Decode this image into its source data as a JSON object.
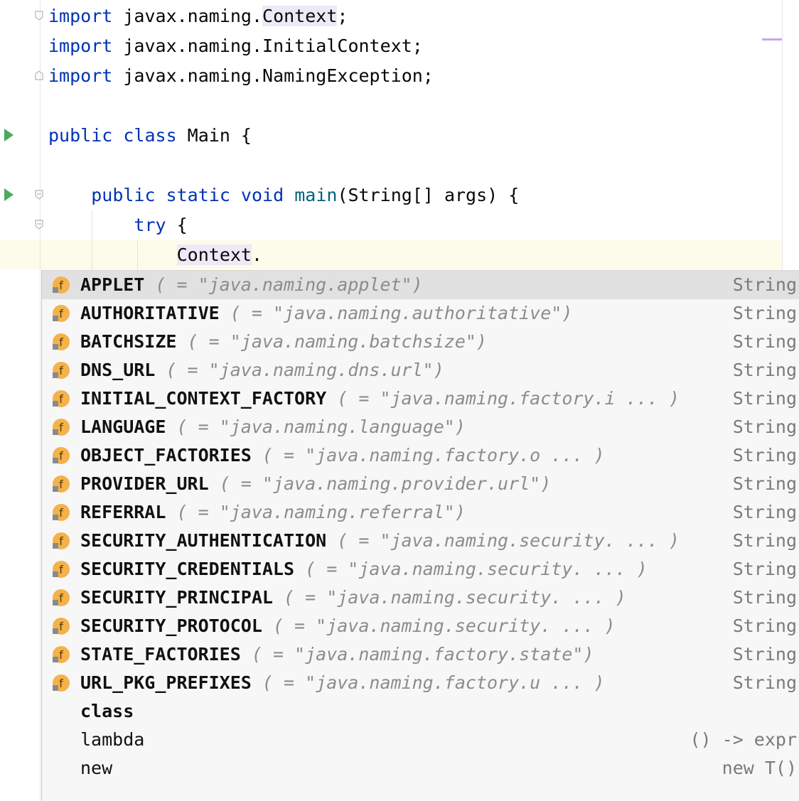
{
  "editor": {
    "lines": [
      {
        "segments": [
          {
            "t": "import",
            "c": "kw"
          },
          {
            "t": " javax.naming."
          },
          {
            "t": "Context",
            "c": "hl"
          },
          {
            "t": ";"
          }
        ]
      },
      {
        "segments": [
          {
            "t": "import",
            "c": "kw"
          },
          {
            "t": " javax.naming.InitialContext;"
          }
        ]
      },
      {
        "segments": [
          {
            "t": "import",
            "c": "kw"
          },
          {
            "t": " javax.naming.NamingException;"
          }
        ]
      },
      {
        "segments": []
      },
      {
        "segments": [
          {
            "t": "public class",
            "c": "kw"
          },
          {
            "t": " Main {"
          }
        ]
      },
      {
        "segments": []
      },
      {
        "segments": [
          {
            "t": "    "
          },
          {
            "t": "public static void",
            "c": "kw"
          },
          {
            "t": " "
          },
          {
            "t": "main",
            "c": "fn"
          },
          {
            "t": "(String[] args) {"
          }
        ]
      },
      {
        "segments": [
          {
            "t": "        "
          },
          {
            "t": "try",
            "c": "kw"
          },
          {
            "t": " {"
          }
        ]
      },
      {
        "segments": [
          {
            "t": "            "
          },
          {
            "t": "Context",
            "c": "hl"
          },
          {
            "t": "."
          }
        ]
      }
    ]
  },
  "completion": {
    "items": [
      {
        "name": "APPLET",
        "tail": "( = \"java.naming.applet\")",
        "type": "String",
        "icon": "field-icon"
      },
      {
        "name": "AUTHORITATIVE",
        "tail": "( = \"java.naming.authoritative\")",
        "type": "String",
        "icon": "field-icon"
      },
      {
        "name": "BATCHSIZE",
        "tail": "( = \"java.naming.batchsize\")",
        "type": "String",
        "icon": "field-icon"
      },
      {
        "name": "DNS_URL",
        "tail": "( = \"java.naming.dns.url\")",
        "type": "String",
        "icon": "field-icon"
      },
      {
        "name": "INITIAL_CONTEXT_FACTORY",
        "tail": "( = \"java.naming.factory.i ... )",
        "type": "String",
        "icon": "field-icon"
      },
      {
        "name": "LANGUAGE",
        "tail": "( = \"java.naming.language\")",
        "type": "String",
        "icon": "field-icon"
      },
      {
        "name": "OBJECT_FACTORIES",
        "tail": "( = \"java.naming.factory.o ... )",
        "type": "String",
        "icon": "field-icon"
      },
      {
        "name": "PROVIDER_URL",
        "tail": "( = \"java.naming.provider.url\")",
        "type": "String",
        "icon": "field-icon"
      },
      {
        "name": "REFERRAL",
        "tail": "( = \"java.naming.referral\")",
        "type": "String",
        "icon": "field-icon"
      },
      {
        "name": "SECURITY_AUTHENTICATION",
        "tail": "( = \"java.naming.security. ... )",
        "type": "String",
        "icon": "field-icon"
      },
      {
        "name": "SECURITY_CREDENTIALS",
        "tail": "( = \"java.naming.security. ... )",
        "type": "String",
        "icon": "field-icon"
      },
      {
        "name": "SECURITY_PRINCIPAL",
        "tail": "( = \"java.naming.security. ... )",
        "type": "String",
        "icon": "field-icon"
      },
      {
        "name": "SECURITY_PROTOCOL",
        "tail": "( = \"java.naming.security. ... )",
        "type": "String",
        "icon": "field-icon"
      },
      {
        "name": "STATE_FACTORIES",
        "tail": "( = \"java.naming.factory.state\")",
        "type": "String",
        "icon": "field-icon"
      },
      {
        "name": "URL_PKG_PREFIXES",
        "tail": "( = \"java.naming.factory.u ... )",
        "type": "String",
        "icon": "field-icon"
      },
      {
        "name": "class",
        "tail": "",
        "type": "",
        "icon": "",
        "bold": true
      },
      {
        "name": "lambda",
        "tail": "",
        "type": "() -> expr",
        "icon": "",
        "bold": false
      },
      {
        "name": "new",
        "tail": "",
        "type": "new T()",
        "icon": "",
        "bold": false
      }
    ]
  },
  "colors": {
    "keyword": "#0033b3",
    "field_icon_bg": "#f4b24a",
    "run_icon": "#4caa5d"
  }
}
